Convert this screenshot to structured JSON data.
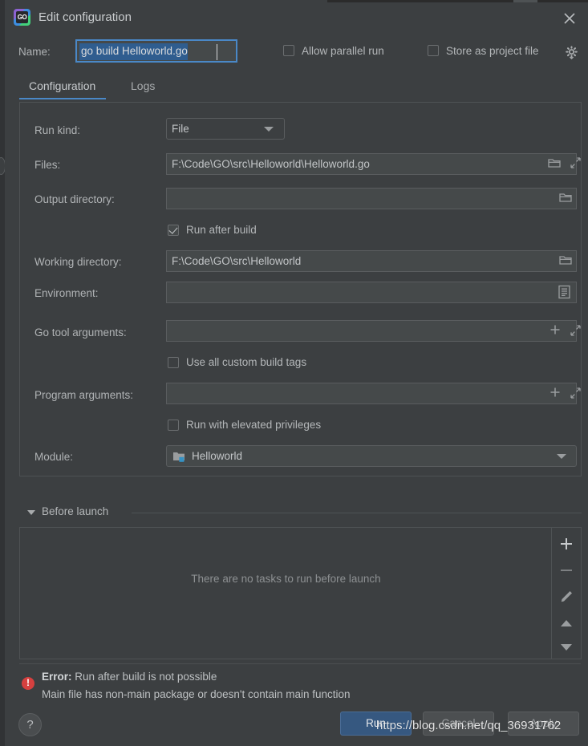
{
  "window": {
    "title": "Edit configuration",
    "app_icon": "goland-icon",
    "icon_text": "GO",
    "close_icon": "close-icon"
  },
  "name_row": {
    "label": "Name:",
    "value": "go build Helloworld.go",
    "allow_parallel_run": {
      "label": "Allow parallel run",
      "checked": false
    },
    "store_as_project_file": {
      "label": "Store as project file",
      "checked": false
    },
    "gear_icon": "gear-icon"
  },
  "tabs": [
    {
      "label": "Configuration",
      "active": true
    },
    {
      "label": "Logs",
      "active": false
    }
  ],
  "configuration": {
    "run_kind": {
      "label": "Run kind:",
      "value": "File"
    },
    "files": {
      "label": "Files:",
      "value": "F:\\Code\\GO\\src\\Helloworld\\Helloworld.go"
    },
    "output_directory": {
      "label": "Output directory:",
      "value": ""
    },
    "run_after_build": {
      "label": "Run after build",
      "checked": true
    },
    "working_directory": {
      "label": "Working directory:",
      "value": "F:\\Code\\GO\\src\\Helloworld"
    },
    "environment": {
      "label": "Environment:",
      "value": ""
    },
    "go_tool_arguments": {
      "label": "Go tool arguments:",
      "value": ""
    },
    "use_all_custom_build_tags": {
      "label": "Use all custom build tags",
      "checked": false
    },
    "program_arguments": {
      "label": "Program arguments:",
      "value": ""
    },
    "run_with_elevated_privileges": {
      "label": "Run with elevated privileges",
      "checked": false
    },
    "module": {
      "label": "Module:",
      "value": "Helloworld"
    }
  },
  "before_launch": {
    "title": "Before launch",
    "empty_text": "There are no tasks to run before launch",
    "toolbar": {
      "add": "add-icon",
      "remove": "remove-icon",
      "edit": "edit-pencil-icon",
      "move_up": "move-up-icon",
      "move_down": "move-down-icon"
    }
  },
  "error": {
    "title": "Error:",
    "line1": "Run after build is not possible",
    "line2": "Main file has non-main package or doesn't contain main function",
    "icon": "error-icon"
  },
  "footer": {
    "help": "?",
    "run": "Run",
    "cancel": "Cancel",
    "apply": "Apply"
  },
  "watermark": "https://blog.csdn.net/qq_36931762",
  "colors": {
    "background": "#3c3f41",
    "field_background": "#45494a",
    "accent": "#4a88c7",
    "primary_button": "#365880",
    "selection": "#2f5d8f",
    "error": "#d5403f",
    "text": "#bbbbbb"
  }
}
